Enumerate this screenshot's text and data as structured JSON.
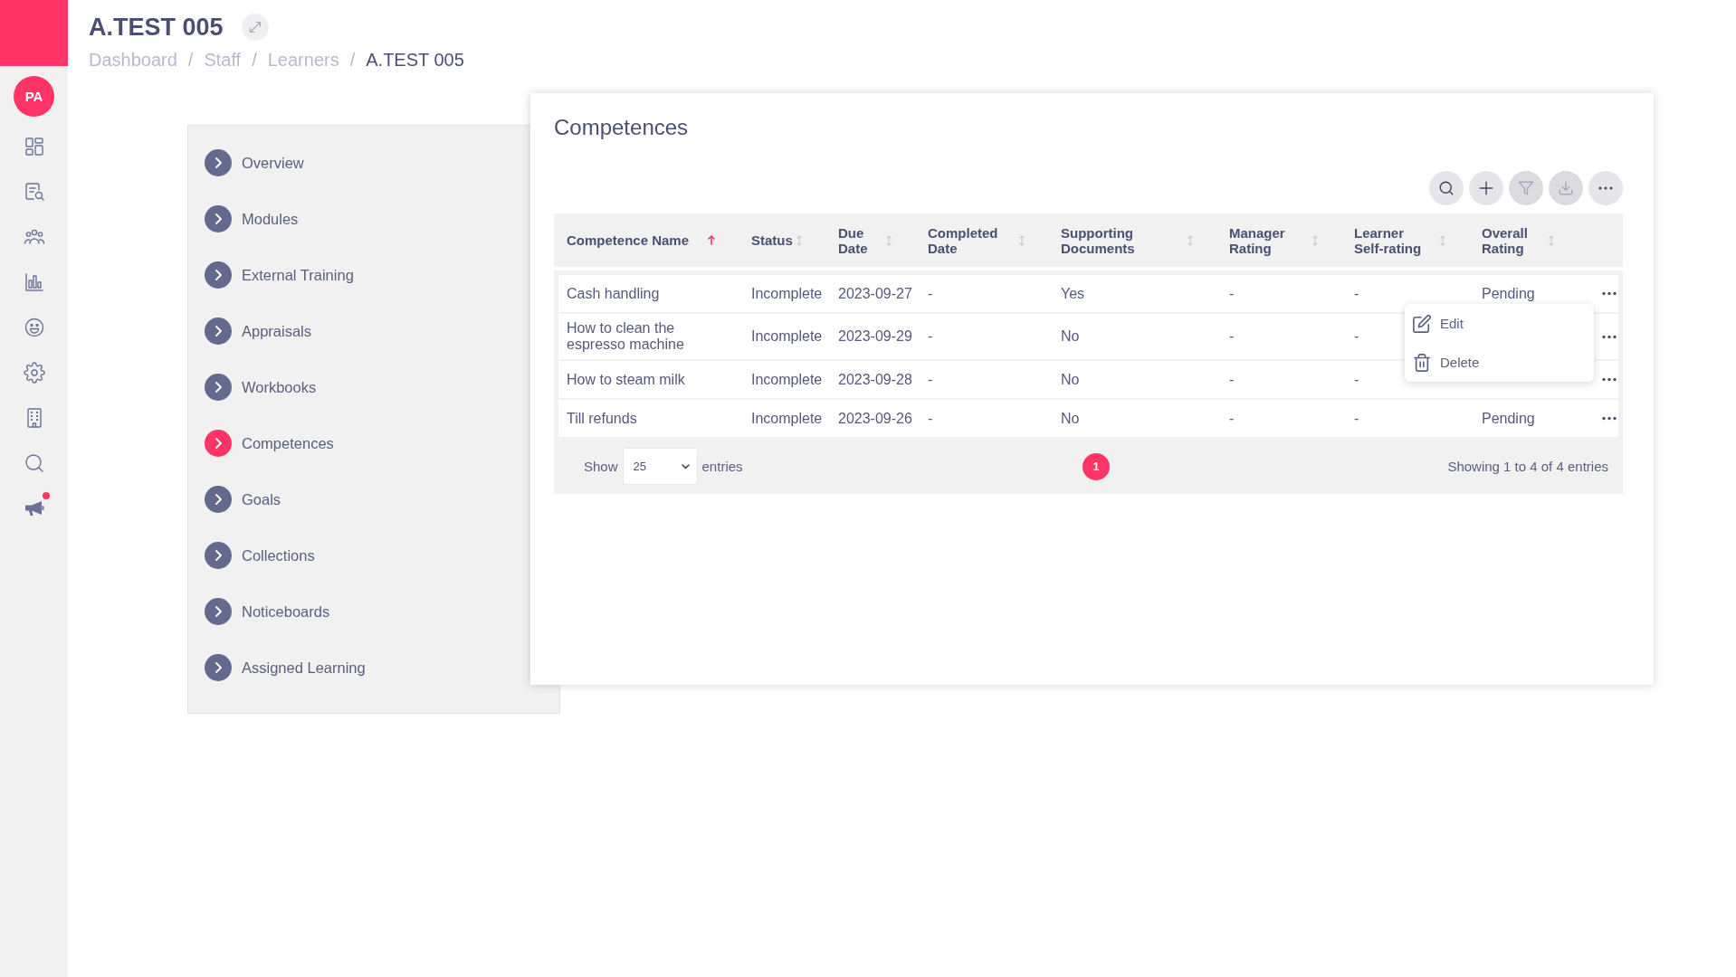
{
  "sidebar": {
    "avatar": "PA",
    "items": [
      {
        "kind": "grid",
        "notification": false
      },
      {
        "kind": "document-search",
        "notification": false
      },
      {
        "kind": "people",
        "notification": false
      },
      {
        "kind": "bar-chart",
        "notification": false
      },
      {
        "kind": "smiley",
        "notification": false
      },
      {
        "kind": "gear",
        "notification": false
      },
      {
        "kind": "building",
        "notification": false
      },
      {
        "kind": "search",
        "notification": false
      },
      {
        "kind": "megaphone",
        "notification": true
      }
    ]
  },
  "header": {
    "title": "A.TEST 005",
    "breadcrumbs": [
      {
        "label": "Dashboard",
        "current": false,
        "separator": "/"
      },
      {
        "label": "Staff",
        "current": false,
        "separator": "/"
      },
      {
        "label": "Learners",
        "current": false,
        "separator": "/"
      },
      {
        "label": "A.TEST 005",
        "current": true
      }
    ]
  },
  "nav": {
    "items": [
      {
        "label": "Overview",
        "selected": false
      },
      {
        "label": "Modules",
        "selected": false
      },
      {
        "label": "External Training",
        "selected": false
      },
      {
        "label": "Appraisals",
        "selected": false
      },
      {
        "label": "Workbooks",
        "selected": false
      },
      {
        "label": "Competences",
        "selected": true
      },
      {
        "label": "Goals",
        "selected": false
      },
      {
        "label": "Collections",
        "selected": false
      },
      {
        "label": "Noticeboards",
        "selected": false
      },
      {
        "label": "Assigned Learning",
        "selected": false
      }
    ]
  },
  "card": {
    "title": "Competences",
    "toolbar": [
      {
        "kind": "search",
        "disabled": false
      },
      {
        "kind": "add",
        "disabled": false
      },
      {
        "kind": "filter",
        "disabled": true
      },
      {
        "kind": "download",
        "disabled": true
      },
      {
        "kind": "more",
        "disabled": false
      }
    ],
    "table": {
      "columns": [
        {
          "label": "Competence Name",
          "sorted": true
        },
        {
          "label": "Status",
          "sorted": false
        },
        {
          "label": "Due Date",
          "sorted": false
        },
        {
          "label": "Completed Date",
          "sorted": false
        },
        {
          "label": "Supporting Documents",
          "sorted": false
        },
        {
          "label": "Manager Rating",
          "sorted": false
        },
        {
          "label": "Learner Self-rating",
          "sorted": false
        },
        {
          "label": "Overall Rating",
          "sorted": false
        }
      ],
      "rows": [
        {
          "name": "Cash handling",
          "status": "Incomplete",
          "due_date": "2023-09-27",
          "completed_date": "-",
          "supporting_documents": "Yes",
          "manager_rating": "-",
          "learner_self_rating": "-",
          "overall_rating": "Pending"
        },
        {
          "name": "How to clean the espresso machine",
          "status": "Incomplete",
          "due_date": "2023-09-29",
          "completed_date": "-",
          "supporting_documents": "No",
          "manager_rating": "-",
          "learner_self_rating": "-"
        },
        {
          "name": "How to steam milk",
          "status": "Incomplete",
          "due_date": "2023-09-28",
          "completed_date": "-",
          "supporting_documents": "No",
          "manager_rating": "-",
          "learner_self_rating": "-"
        },
        {
          "name": "Till refunds",
          "status": "Incomplete",
          "due_date": "2023-09-26",
          "completed_date": "-",
          "supporting_documents": "No",
          "manager_rating": "-",
          "learner_self_rating": "-",
          "overall_rating": "Pending"
        }
      ],
      "context_menu": {
        "items": [
          {
            "kind": "edit",
            "label": "Edit"
          },
          {
            "kind": "delete",
            "label": "Delete"
          }
        ]
      },
      "footer": {
        "show_label": "Show",
        "page_size": "25",
        "entries_label": "entries",
        "pages": [
          {
            "label": "1",
            "selected": true
          }
        ],
        "info": "Showing 1 to 4 of 4 entries"
      }
    }
  }
}
